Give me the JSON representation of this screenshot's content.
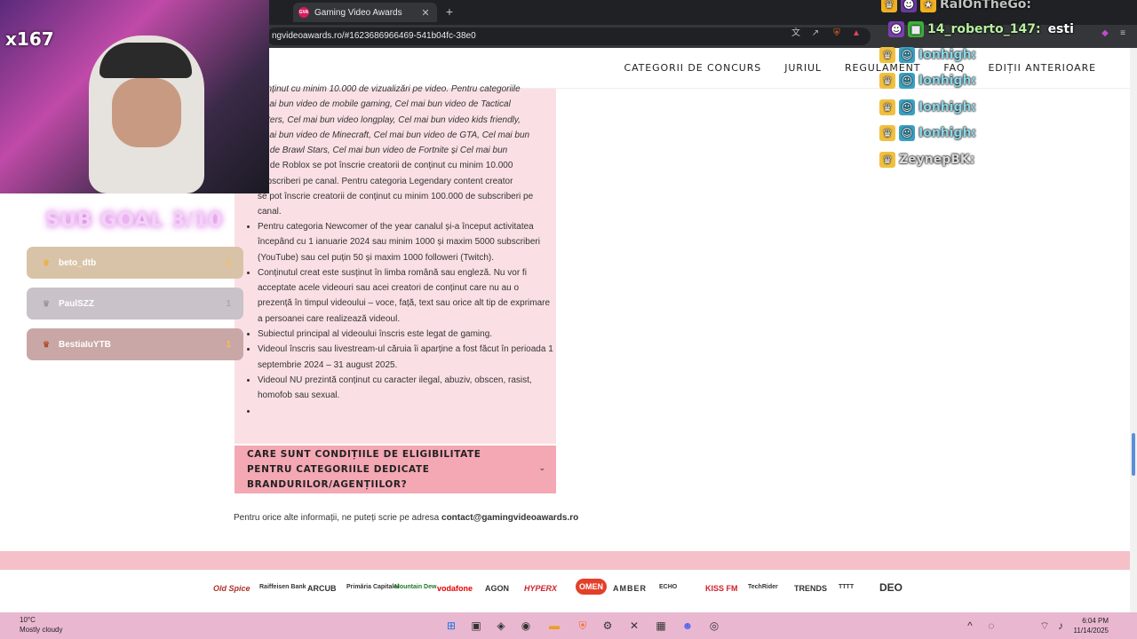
{
  "browser": {
    "tab_title": "Gaming Video Awards",
    "tab_favicon_text": "GVA",
    "url": "ngvideoawards.ro/#1623686966469-541b04fc-38e0"
  },
  "nav": {
    "items": [
      {
        "label": "CATEGORII DE CONCURS"
      },
      {
        "label": "JURIUL"
      },
      {
        "label": "REGULAMENT"
      },
      {
        "label": "FAQ"
      },
      {
        "label": "EDIȚII ANTERIOARE"
      }
    ]
  },
  "rules": {
    "top_lines": [
      "conținut cu minim 10.000 de vizualizări pe video. Pentru categoriile",
      "l mai bun video de mobile gaming, Cel mai bun video de Tactical",
      "ooters, Cel mai bun video longplay, Cel mai bun video kids friendly,",
      "l mai bun video de Minecraft, Cel mai bun video de GTA, Cel mai bun",
      "eo de Brawl Stars, Cel mai bun video de Fortnite și Cel mai bun",
      "eo de Roblox se pot înscrie creatorii de conținut cu minim 10.000",
      "subscriberi pe canal. Pentru categoria Legendary content creator",
      "se pot înscrie creatorii de conținut cu minim 100.000 de subscriberi pe",
      "canal."
    ],
    "items": [
      "Pentru categoria Newcomer of the year canalul și-a început activitatea începând cu 1 ianuarie 2024 sau minim 1000 și maxim 5000 subscriberi (YouTube) sau cel puțin 50 și maxim 1000 followeri (Twitch).",
      "Conținutul creat este susținut în limba română sau engleză. Nu vor fi acceptate acele videouri sau acei creatori de conținut care nu au o prezență în timpul videoului – voce, față, text sau orice alt tip de exprimare a persoanei care realizează videoul.",
      "Subiectul principal al videoului înscris este legat de gaming.",
      "Videoul înscris sau livestream-ul căruia îi aparține a fost făcut în perioada 1 septembrie 2024 – 31 august 2025.",
      "Videoul NU prezintă conținut cu caracter ilegal, abuziv, obscen, rasist, homofob sau sexual.",
      ""
    ]
  },
  "faq_question": "CARE SUNT CONDIȚIILE DE ELIGIBILITATE PENTRU CATEGORIILE DEDICATE BRANDURILOR/AGENȚIILOR?",
  "contact": {
    "prefix": "Pentru orice alte informații, ne puteți scrie pe adresa ",
    "email": "contact@gamingvideoawards.ro"
  },
  "sponsors": [
    "Old Spice",
    "Raiffeisen Bank",
    "ARCUB",
    "Primăria Capitalei",
    "Mountain Dew",
    "vodafone",
    "AGON",
    "HYPERX",
    "OMEN",
    "AMBER",
    "ECHO",
    "KISS FM",
    "TechRider",
    "TRENDS",
    "TTTT",
    "DEO"
  ],
  "stream": {
    "counter": "x167",
    "sub_goal": "SUB GOAL 3/10",
    "subs": [
      {
        "name": "beto_dtb",
        "count": "1",
        "color": "#d9c3a8"
      },
      {
        "name": "PaulSZZ",
        "count": "1",
        "color": "#c9c2c8"
      },
      {
        "name": "BestiaIuYTB",
        "count": "1",
        "color": "#c8a7a6"
      }
    ],
    "chat": [
      {
        "name": "RaIOnTheGo:",
        "text": ""
      },
      {
        "name": "14_roberto_147:",
        "text": "esti"
      },
      {
        "name": "Ionhigh:",
        "text": ""
      },
      {
        "name": "Ionhigh:",
        "text": ""
      },
      {
        "name": "Ionhigh:",
        "text": ""
      },
      {
        "name": "Ionhigh:",
        "text": ""
      },
      {
        "name": "ZeynepBK:",
        "text": ""
      }
    ]
  },
  "taskbar": {
    "weather_temp": "10°C",
    "weather_desc": "Mostly cloudy",
    "time": "6:04 PM",
    "date": "11/14/2025"
  }
}
